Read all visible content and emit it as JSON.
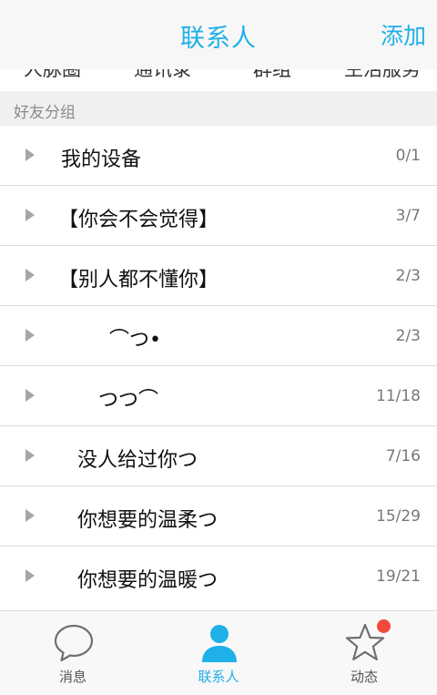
{
  "header": {
    "title": "联系人",
    "add_label": "添加"
  },
  "subtabs": [
    "人脉圈",
    "通讯录",
    "群组",
    "生活服务"
  ],
  "section": {
    "label": "好友分组"
  },
  "groups": [
    {
      "name": "我的设备",
      "count": "0/1"
    },
    {
      "name": "【你会不会觉得】",
      "count": "3/7"
    },
    {
      "name": "【别人都不懂你】",
      "count": "2/3"
    },
    {
      "name": "⌒つ•",
      "count": "2/3"
    },
    {
      "name": "つつ⌒",
      "count": "11/18"
    },
    {
      "name": "没人给过你つ",
      "count": "7/16"
    },
    {
      "name": "你想要的温柔つ",
      "count": "15/29"
    },
    {
      "name": "你想要的温暖つ",
      "count": "19/21"
    }
  ],
  "tabbar": {
    "items": [
      {
        "label": "消息",
        "icon": "chat-bubble-icon"
      },
      {
        "label": "联系人",
        "icon": "person-icon",
        "active": true
      },
      {
        "label": "动态",
        "icon": "star-icon"
      }
    ]
  },
  "colors": {
    "accent": "#1eb0e8",
    "badge": "#f24a3a"
  }
}
